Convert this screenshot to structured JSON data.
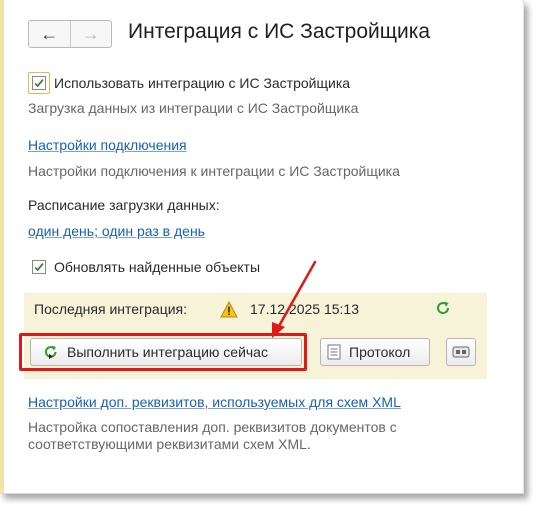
{
  "header": {
    "back_icon": "arrow-left-icon",
    "forward_icon": "arrow-right-icon",
    "title": "Интеграция с ИС Застройщика"
  },
  "integration": {
    "checked": true,
    "label": "Использовать интеграцию с ИС Застройщика",
    "description": "Загрузка данных из интеграции с ИС Застройщика"
  },
  "connection": {
    "link": "Настройки подключения",
    "description": "Настройки подключения к интеграции с ИС Застройщика"
  },
  "schedule": {
    "label": "Расписание загрузки данных:",
    "link": "один день; один раз в день"
  },
  "update_found": {
    "checked": true,
    "label": "Обновлять найденные объекты"
  },
  "last_integration": {
    "label": "Последняя интеграция:",
    "status_icon": "warning-icon",
    "value": "17.12.2025 15:13",
    "refresh_icon": "refresh-icon"
  },
  "actions": {
    "run_label": "Выполнить интеграцию сейчас",
    "protocol_label": "Протокол",
    "extra_icon": "settings-icon"
  },
  "xml": {
    "link": "Настройки доп. реквизитов, используемых для схем XML",
    "description_line1": "Настройка сопоставления доп. реквизитов документов с",
    "description_line2": "соответствующими реквизитами схем XML."
  },
  "colors": {
    "link": "#1a5fb4",
    "highlight": "#e01818",
    "panel": "#f6f3d9",
    "checkmark": "#2e7d32"
  }
}
